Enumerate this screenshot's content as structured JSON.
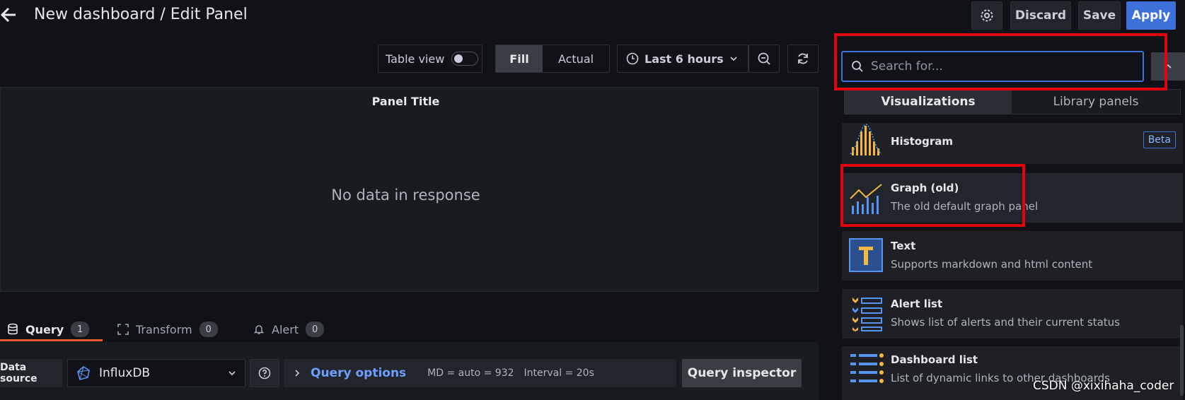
{
  "header": {
    "breadcrumb": "New dashboard / Edit Panel",
    "discard_label": "Discard",
    "save_label": "Save",
    "apply_label": "Apply"
  },
  "toolbar": {
    "table_view_label": "Table view",
    "fill_label": "Fill",
    "actual_label": "Actual",
    "time_range_label": "Last 6 hours"
  },
  "panel": {
    "title": "Panel Title",
    "empty_message": "No data in response"
  },
  "query_tabs": [
    {
      "label": "Query",
      "count": "1"
    },
    {
      "label": "Transform",
      "count": "0"
    },
    {
      "label": "Alert",
      "count": "0"
    }
  ],
  "query_row": {
    "datasource_label": "Data source",
    "datasource_value": "InfluxDB",
    "query_options_label": "Query options",
    "md_info": "MD = auto = 932",
    "interval_info": "Interval = 20s",
    "inspector_label": "Query inspector"
  },
  "viz_picker": {
    "search_placeholder": "Search for...",
    "tab_visualizations": "Visualizations",
    "tab_library": "Library panels",
    "items": [
      {
        "title": "Histogram",
        "desc": "",
        "badge": "Beta"
      },
      {
        "title": "Graph (old)",
        "desc": "The old default graph panel"
      },
      {
        "title": "Text",
        "desc": "Supports markdown and html content"
      },
      {
        "title": "Alert list",
        "desc": "Shows list of alerts and their current status"
      },
      {
        "title": "Dashboard list",
        "desc": "List of dynamic links to other dashboards"
      }
    ]
  },
  "watermark": "CSDN @xixihaha_coder",
  "colors": {
    "apply_blue": "#3d71d9",
    "highlight_red": "#e3000f",
    "query_tab_orange": "#f05a28",
    "icon_yellow": "#f5b73d",
    "icon_blue": "#5794f2"
  }
}
